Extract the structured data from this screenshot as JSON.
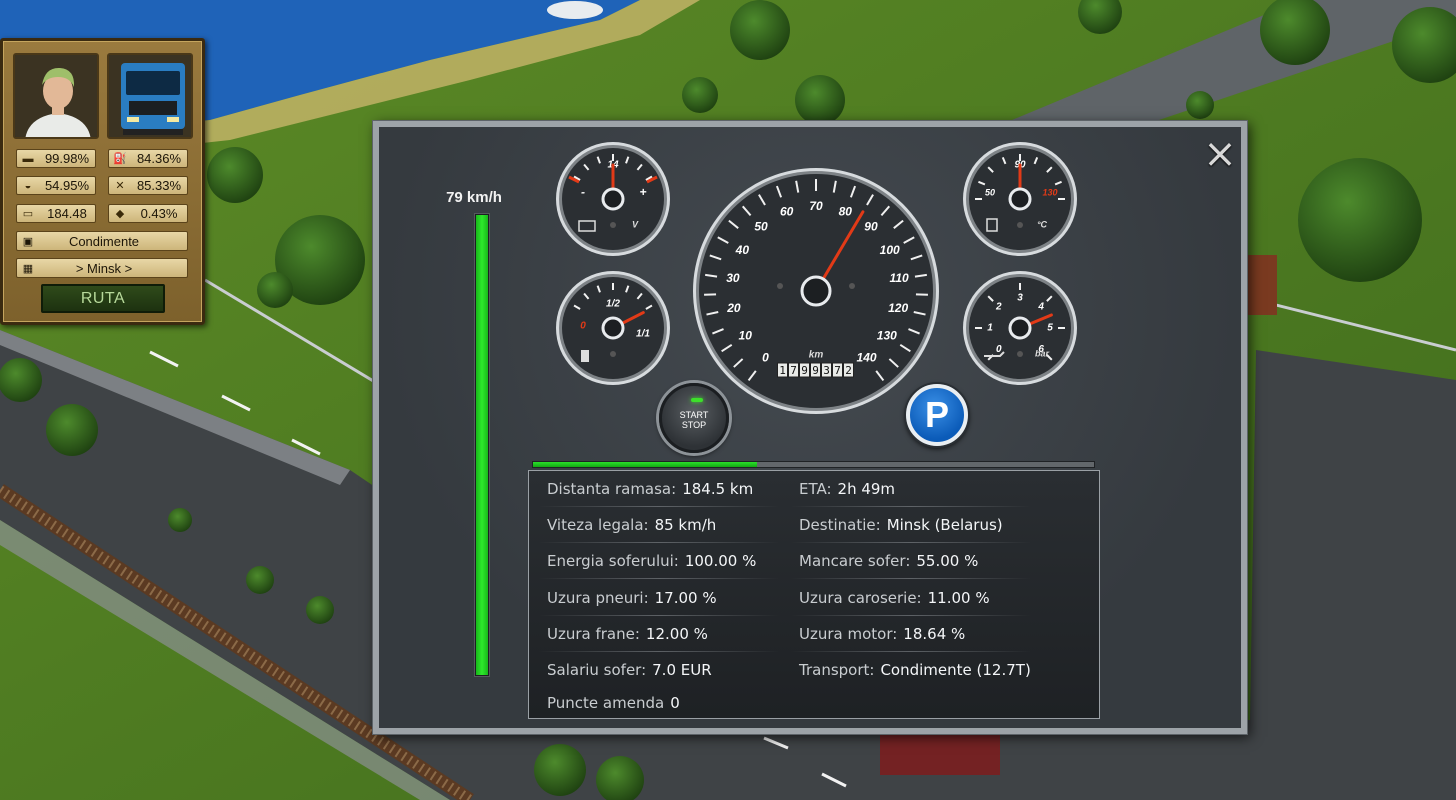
{
  "status_panel": {
    "stats": [
      {
        "icon": "bed-icon",
        "value": "99.98%"
      },
      {
        "icon": "fuel-pump-icon",
        "value": "84.36%"
      },
      {
        "icon": "food-icon",
        "value": "54.95%"
      },
      {
        "icon": "wrench-icon",
        "value": "85.33%"
      },
      {
        "icon": "money-icon",
        "value": "184.48"
      },
      {
        "icon": "truck-damage-icon",
        "value": "0.43%"
      }
    ],
    "cargo": {
      "icon": "cargo-box-icon",
      "value": "Condimente"
    },
    "destination": {
      "icon": "map-icon",
      "value": "> Minsk >"
    },
    "route_button": "RUTA"
  },
  "dashboard": {
    "close_icon": "×",
    "speed_text": "79 km/h",
    "speed_bar_fraction": 1.0,
    "trip_progress_fraction": 0.4,
    "start_stop": "START\nSTOP",
    "parking_label": "P",
    "speedometer": {
      "value": 85,
      "unit": "km",
      "ticks": [
        "0",
        "10",
        "20",
        "30",
        "40",
        "50",
        "60",
        "70",
        "80",
        "90",
        "100",
        "110",
        "120",
        "130",
        "140"
      ],
      "odometer": "1799372"
    },
    "battery_gauge": {
      "ticks": [
        "14",
        "-",
        "+"
      ],
      "unit": "V",
      "value_fraction": 0.5
    },
    "fuel_gauge": {
      "ticks": [
        "0",
        "1/2",
        "1/1"
      ],
      "value_fraction": 0.85
    },
    "temp_gauge": {
      "ticks": [
        "50",
        "90",
        "130"
      ],
      "unit": "°C",
      "value_fraction": 0.5
    },
    "oil_gauge": {
      "ticks": [
        "0",
        "1",
        "2",
        "3",
        "4",
        "5",
        "6"
      ],
      "unit": "bar",
      "value": 4.5
    },
    "info": {
      "left": [
        {
          "label": "Distanta ramasa:",
          "value": "184.5 km"
        },
        {
          "label": "Viteza legala:",
          "value": "85 km/h"
        },
        {
          "label": "Energia soferului:",
          "value": "100.00 %"
        },
        {
          "label": "Uzura pneuri:",
          "value": "17.00 %"
        },
        {
          "label": "Uzura frane:",
          "value": "12.00 %"
        },
        {
          "label": "Salariu sofer:",
          "value": "7.0 EUR"
        },
        {
          "label": "Puncte amenda",
          "value": "0"
        }
      ],
      "right": [
        {
          "label": "ETA:",
          "value": "2h 49m"
        },
        {
          "label": "Destinatie:",
          "value": "Minsk (Belarus)"
        },
        {
          "label": "Mancare sofer:",
          "value": "55.00 %"
        },
        {
          "label": "Uzura caroserie:",
          "value": "11.00 %"
        },
        {
          "label": "Uzura motor:",
          "value": "18.64 %"
        },
        {
          "label": "Transport:",
          "value": "Condimente (12.7T)"
        }
      ]
    }
  }
}
